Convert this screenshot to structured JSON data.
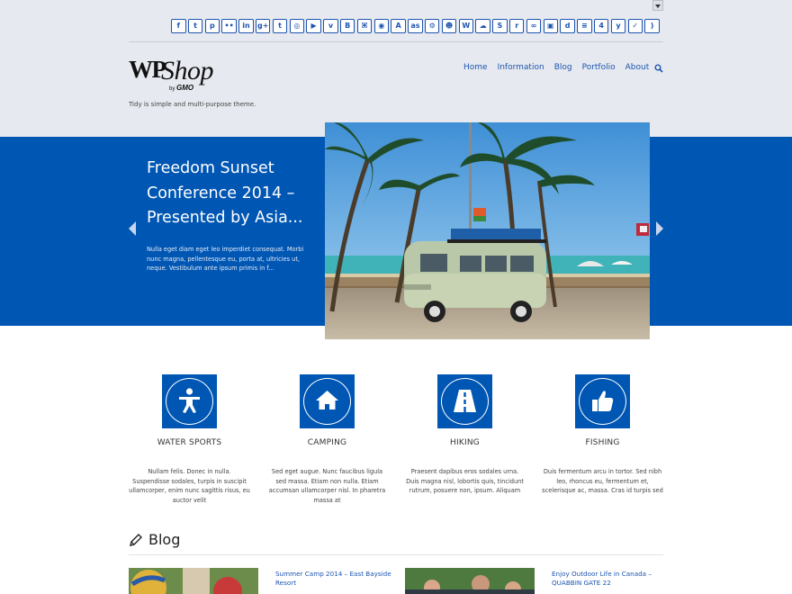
{
  "site": {
    "tagline": "Tidy is simple and multi-purpose theme."
  },
  "social_icons": [
    {
      "name": "facebook-icon",
      "glyph": "f"
    },
    {
      "name": "twitter-icon",
      "glyph": "t"
    },
    {
      "name": "pinterest-icon",
      "glyph": "p"
    },
    {
      "name": "flickr-icon",
      "glyph": "••"
    },
    {
      "name": "linkedin-icon",
      "glyph": "in"
    },
    {
      "name": "google-plus-icon",
      "glyph": "g+"
    },
    {
      "name": "tumblr-icon",
      "glyph": "t"
    },
    {
      "name": "instagram-icon",
      "glyph": "◎"
    },
    {
      "name": "youtube-icon",
      "glyph": "▶"
    },
    {
      "name": "vimeo-icon",
      "glyph": "v"
    },
    {
      "name": "blogger-icon",
      "glyph": "B"
    },
    {
      "name": "github-icon",
      "glyph": "⌘"
    },
    {
      "name": "dribbble-icon",
      "glyph": "◉"
    },
    {
      "name": "appnet-icon",
      "glyph": "A"
    },
    {
      "name": "lastfm-icon",
      "glyph": "as"
    },
    {
      "name": "steam-icon",
      "glyph": "⚙"
    },
    {
      "name": "reddit-alien-icon",
      "glyph": "☻"
    },
    {
      "name": "wordpress-icon",
      "glyph": "W"
    },
    {
      "name": "soundcloud-icon",
      "glyph": "☁"
    },
    {
      "name": "skype-icon",
      "glyph": "S"
    },
    {
      "name": "reddit-icon",
      "glyph": "r"
    },
    {
      "name": "delicious-icon",
      "glyph": "∞"
    },
    {
      "name": "evernote-icon",
      "glyph": "▣"
    },
    {
      "name": "deviantart-icon",
      "glyph": "d"
    },
    {
      "name": "stack-icon",
      "glyph": "≡"
    },
    {
      "name": "foursquare-icon",
      "glyph": "4"
    },
    {
      "name": "yelp-icon",
      "glyph": "y"
    },
    {
      "name": "ok-icon",
      "glyph": "✓"
    },
    {
      "name": "rss-icon",
      "glyph": ")"
    }
  ],
  "nav": {
    "items": [
      "Home",
      "Information",
      "Blog",
      "Portfolio",
      "About"
    ]
  },
  "slider": {
    "title": "Freedom Sunset Conference  2014 – Presented by Asia...",
    "excerpt": "Nulla eget diam eget leo imperdiet consequat. Morbi nunc magna, pellentesque eu, porta at, ultricies ut, neque. Vestibulum ante ipsum primis in f..."
  },
  "features": [
    {
      "title": "WATER SPORTS",
      "icon": "person-icon",
      "text": "Nullam felis. Donec in nulla. Suspendisse sodales, turpis in suscipit ullamcorper, enim nunc sagittis risus, eu auctor velit"
    },
    {
      "title": "CAMPING",
      "icon": "home-icon",
      "text": "Sed eget augue. Nunc faucibus ligula sed massa. Etiam non nulla. Etiam accumsan ullamcorper nisl. In pharetra massa at"
    },
    {
      "title": "HIKING",
      "icon": "road-icon",
      "text": "Praesent dapibus eros sodales urna. Duis magna nisl, lobortis quis, tincidunt rutrum, posuere non, ipsum. Aliquam"
    },
    {
      "title": "FISHING",
      "icon": "thumbs-up-icon",
      "text": "Duis fermentum arcu in tortor. Sed nibh leo, rhoncus eu, fermentum et, scelerisque ac, massa. Cras id turpis sed"
    }
  ],
  "blog": {
    "heading": "Blog",
    "posts": [
      {
        "title": "Summer Camp 2014 – East Bayside Resort"
      },
      {
        "title": "Enjoy Outdoor Life in Canada – QUABBIN GATE 22"
      }
    ]
  },
  "colors": {
    "brand_blue": "#0056b3",
    "link_blue": "#1d55b0",
    "header_bg": "#e6e9ef"
  }
}
